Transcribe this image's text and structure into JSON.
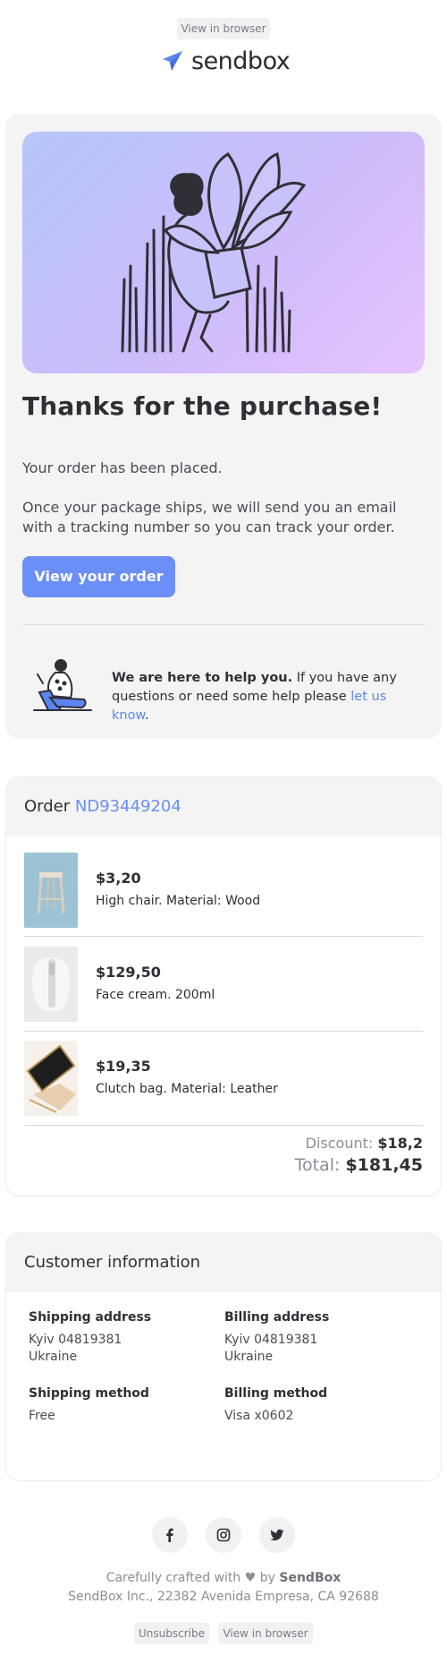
{
  "header": {
    "view_in_browser": "View in browser",
    "logo_text": "sendbox"
  },
  "hero": {
    "title": "Thanks for the purchase!",
    "line1": "Your order has been placed.",
    "line2": "Once your package ships, we will send you an email with a tracking number so you can track your order.",
    "cta_label": "View your order"
  },
  "help": {
    "bold": "We are here to help you.",
    "text": " If you have any questions or need some help please ",
    "link": "let us know",
    "end": "."
  },
  "order": {
    "label": "Order",
    "number": "ND93449204",
    "items": [
      {
        "price": "$3,20",
        "desc": "High chair. Material: Wood"
      },
      {
        "price": "$129,50",
        "desc": "Face cream. 200ml"
      },
      {
        "price": "$19,35",
        "desc": "Clutch bag. Material: Leather"
      }
    ],
    "discount_label": "Discount:",
    "discount_value": "$18,2",
    "total_label": "Total:",
    "total_value": "$181,45"
  },
  "customer": {
    "title": "Customer information",
    "shipping_address_label": "Shipping address",
    "shipping_address_line1": "Kyiv 04819381",
    "shipping_address_line2": "Ukraine",
    "billing_address_label": "Billing address",
    "billing_address_line1": "Kyiv 04819381",
    "billing_address_line2": "Ukraine",
    "shipping_method_label": "Shipping method",
    "shipping_method_value": "Free",
    "billing_method_label": "Billing method",
    "billing_method_value": "Visa x0602"
  },
  "footer": {
    "social_icons": [
      "facebook-icon",
      "instagram-icon",
      "twitter-icon"
    ],
    "crafted_prefix": "Carefully crafted with",
    "crafted_by": "by",
    "crafted_brand": "SendBox",
    "address": "SendBox Inc., 22382 Avenida Empresa, CA 92688",
    "unsubscribe": "Unsubscribe",
    "view_in_browser": "View in browser"
  },
  "colors": {
    "accent": "#6b8ff7",
    "card_bg": "#f4f4f5",
    "text": "#2f2f36"
  }
}
